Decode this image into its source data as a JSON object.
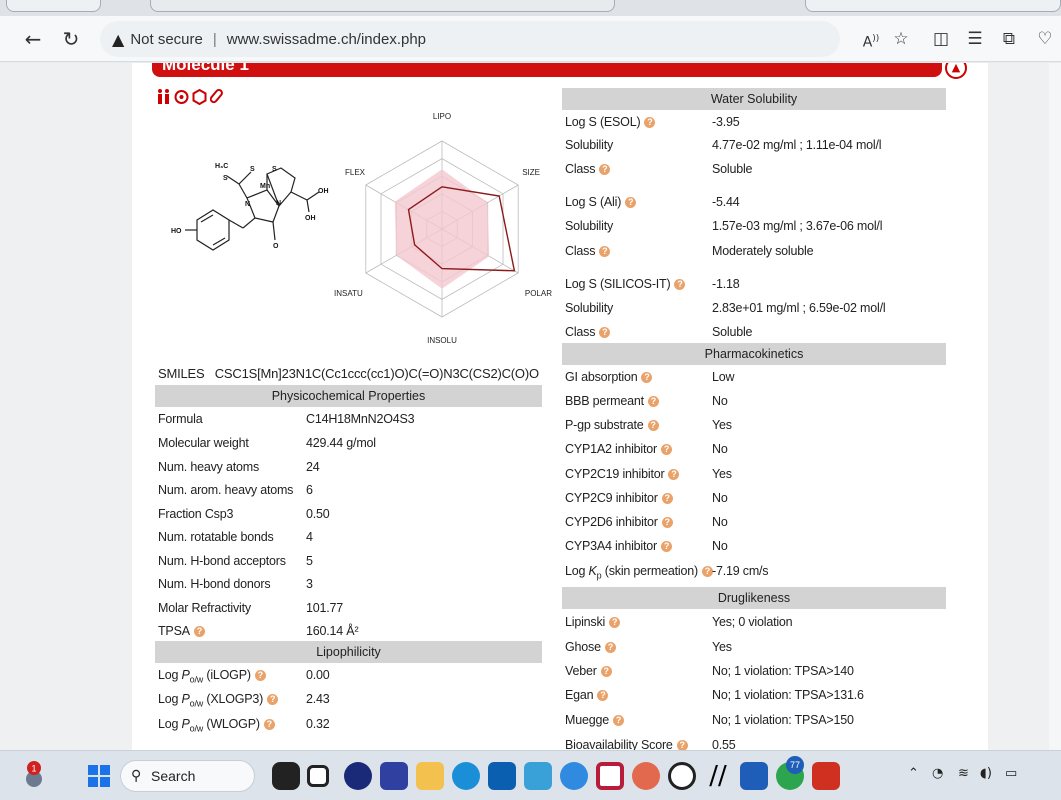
{
  "browser": {
    "security_label": "Not secure",
    "url": "www.swissadme.ch/index.php"
  },
  "molecule": {
    "title": "Molecule 1",
    "smiles_label": "SMILES",
    "smiles": "CSC1S[Mn]23N1C(Cc1ccc(cc1)O)C(=O)N3C(CS2)C(O)O",
    "radar_axes": [
      "LIPO",
      "SIZE",
      "POLAR",
      "INSOLU",
      "INSATU",
      "FLEX"
    ],
    "structure_labels": [
      "H₃C",
      "S",
      "S",
      "S",
      "Mn",
      "N",
      "N",
      "OH",
      "OH",
      "HO",
      "O"
    ]
  },
  "physchem": {
    "header": "Physicochemical Properties",
    "rows": [
      {
        "label": "Formula",
        "value": "C14H18MnN2O4S3"
      },
      {
        "label": "Molecular weight",
        "value": "429.44 g/mol"
      },
      {
        "label": "Num. heavy atoms",
        "value": "24"
      },
      {
        "label": "Num. arom. heavy atoms",
        "value": "6"
      },
      {
        "label": "Fraction Csp3",
        "value": "0.50"
      },
      {
        "label": "Num. rotatable bonds",
        "value": "4"
      },
      {
        "label": "Num. H-bond acceptors",
        "value": "5"
      },
      {
        "label": "Num. H-bond donors",
        "value": "3"
      },
      {
        "label": "Molar Refractivity",
        "value": "101.77"
      },
      {
        "label": "TPSA",
        "value": "160.14 Å²"
      }
    ]
  },
  "lipophilicity": {
    "header": "Lipophilicity",
    "rows": [
      {
        "label_pre": "Log ",
        "label_p": "P",
        "label_sub": "o/w",
        "label_post": " (iLOGP)",
        "value": "0.00"
      },
      {
        "label_pre": "Log ",
        "label_p": "P",
        "label_sub": "o/w",
        "label_post": " (XLOGP3)",
        "value": "2.43"
      },
      {
        "label_pre": "Log ",
        "label_p": "P",
        "label_sub": "o/w",
        "label_post": " (WLOGP)",
        "value": "0.32"
      }
    ]
  },
  "water_solubility": {
    "header": "Water Solubility",
    "rows": [
      {
        "label": "Log S (ESOL)",
        "value": "-3.95"
      },
      {
        "label": "Solubility",
        "value": "4.77e-02 mg/ml ; 1.11e-04 mol/l"
      },
      {
        "label": "Class",
        "value": "Soluble"
      },
      {
        "label": "Log S (Ali)",
        "value": "-5.44"
      },
      {
        "label": "Solubility",
        "value": "1.57e-03 mg/ml ; 3.67e-06 mol/l"
      },
      {
        "label": "Class",
        "value": "Moderately soluble"
      },
      {
        "label": "Log S (SILICOS-IT)",
        "value": "-1.18"
      },
      {
        "label": "Solubility",
        "value": "2.83e+01 mg/ml ; 6.59e-02 mol/l"
      },
      {
        "label": "Class",
        "value": "Soluble"
      }
    ]
  },
  "pharmacokinetics": {
    "header": "Pharmacokinetics",
    "rows": [
      {
        "label": "GI absorption",
        "value": "Low"
      },
      {
        "label": "BBB permeant",
        "value": "No"
      },
      {
        "label": "P-gp substrate",
        "value": "Yes"
      },
      {
        "label": "CYP1A2 inhibitor",
        "value": "No"
      },
      {
        "label": "CYP2C19 inhibitor",
        "value": "Yes"
      },
      {
        "label": "CYP2C9 inhibitor",
        "value": "No"
      },
      {
        "label": "CYP2D6 inhibitor",
        "value": "No"
      },
      {
        "label": "CYP3A4 inhibitor",
        "value": "No"
      },
      {
        "label_pre": "Log ",
        "label_k": "K",
        "label_sub": "p",
        "label_post": " (skin permeation)",
        "value": "-7.19 cm/s"
      }
    ]
  },
  "druglikeness": {
    "header": "Druglikeness",
    "rows": [
      {
        "label": "Lipinski",
        "value": "Yes; 0 violation"
      },
      {
        "label": "Ghose",
        "value": "Yes"
      },
      {
        "label": "Veber",
        "value": "No; 1 violation: TPSA>140"
      },
      {
        "label": "Egan",
        "value": "No; 1 violation: TPSA>131.6"
      },
      {
        "label": "Muegge",
        "value": "No; 1 violation: TPSA>150"
      },
      {
        "label": "Bioavailability Score",
        "value": "0.55"
      }
    ]
  },
  "taskbar": {
    "search_label": "Search",
    "badge_count_left": "1",
    "badge_count_chrome": "77"
  },
  "colors": {
    "brand_red": "#d01010",
    "info_orange": "#e9a26a",
    "radar_fill": "#f4c7cf",
    "radar_line": "#8b1a1a"
  }
}
